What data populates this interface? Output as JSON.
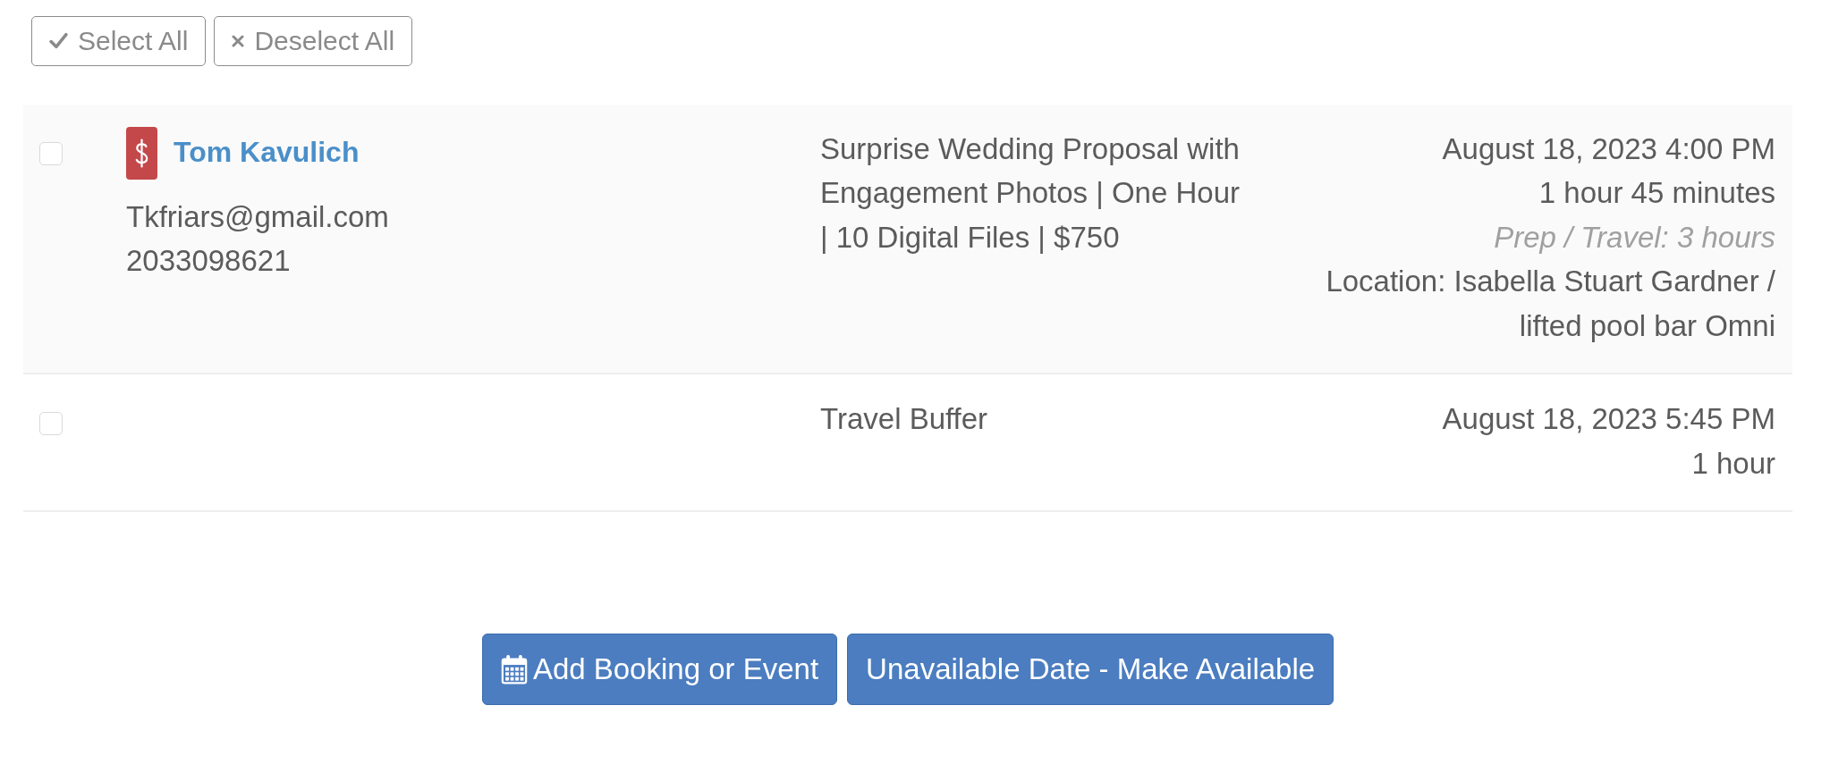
{
  "toolbar": {
    "buttons": [
      {
        "kind": "select",
        "label": "Select All"
      },
      {
        "kind": "deselect",
        "label": "Deselect All"
      }
    ]
  },
  "rows": [
    {
      "checked": false,
      "client": {
        "name": "Tom Kavulich",
        "email": "Tkfriars@gmail.com",
        "phone": "2033098621"
      },
      "title": "Surprise Wedding Proposal with Engagement Photos | One Hour | 10 Digital Files | $750",
      "datetime": "August 18, 2023 4:00 PM",
      "duration": "1 hour 45 minutes",
      "prep": "Prep / Travel: 3 hours",
      "location": "Location: Isabella Stuart Gardner / lifted pool bar Omni"
    },
    {
      "checked": false,
      "title": "Travel Buffer",
      "datetime": "August 18, 2023 5:45 PM",
      "duration": "1 hour"
    }
  ],
  "actions": [
    {
      "kind": "add",
      "label": "Add Booking or Event"
    },
    {
      "kind": "toggle",
      "label": "Unavailable Date - Make Available"
    }
  ]
}
